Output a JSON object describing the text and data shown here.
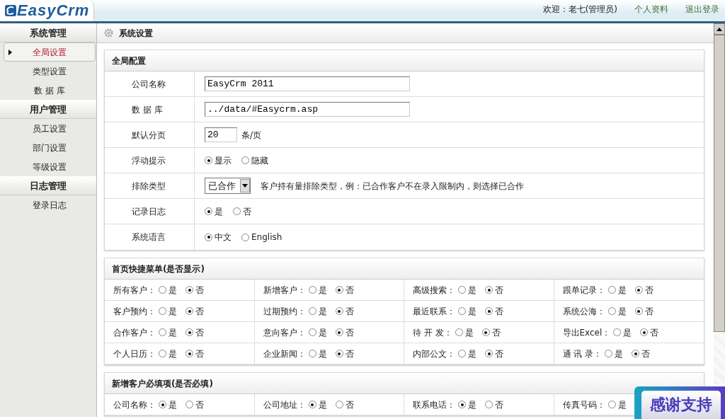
{
  "header": {
    "logo": "EasyCrm",
    "welcome": "欢迎：老七(管理员)",
    "links": [
      "个人资料",
      "退出登录"
    ]
  },
  "sidebar": {
    "groups": [
      {
        "title": "系统管理",
        "items": [
          {
            "label": "全局设置",
            "selected": true
          },
          {
            "label": "类型设置",
            "selected": false
          },
          {
            "label": "数 据 库",
            "selected": false
          }
        ]
      },
      {
        "title": "用户管理",
        "items": [
          {
            "label": "员工设置",
            "selected": false
          },
          {
            "label": "部门设置",
            "selected": false
          },
          {
            "label": "等级设置",
            "selected": false
          }
        ]
      },
      {
        "title": "日志管理",
        "items": [
          {
            "label": "登录日志",
            "selected": false
          }
        ]
      }
    ]
  },
  "page_title": "系统设置",
  "config": {
    "title": "全局配置",
    "rows": [
      {
        "label": "公司名称",
        "kind": "text",
        "value": "EasyCrm 2011"
      },
      {
        "label": "数 据 库",
        "kind": "text",
        "value": "../data/#Easycrm.asp"
      },
      {
        "label": "默认分页",
        "kind": "number",
        "value": "20",
        "unit": "条/页"
      },
      {
        "label": "浮动提示",
        "kind": "radio",
        "options": [
          {
            "label": "显示",
            "selected": true
          },
          {
            "label": "隐藏",
            "selected": false
          }
        ]
      },
      {
        "label": "排除类型",
        "kind": "select",
        "value": "已合作",
        "hint": "客户持有量排除类型，例：已合作客户不在录入限制内，则选择已合作"
      },
      {
        "label": "记录日志",
        "kind": "radio",
        "options": [
          {
            "label": "是",
            "selected": true
          },
          {
            "label": "否",
            "selected": false
          }
        ]
      },
      {
        "label": "系统语言",
        "kind": "radio",
        "options": [
          {
            "label": "中文",
            "selected": true
          },
          {
            "label": "English",
            "selected": false
          }
        ]
      }
    ]
  },
  "quick_menu": {
    "title": "首页快捷菜单(是否显示)",
    "items": [
      {
        "label": "所有客户：",
        "options": [
          {
            "label": "是",
            "selected": false
          },
          {
            "label": "否",
            "selected": true
          }
        ]
      },
      {
        "label": "新增客户：",
        "options": [
          {
            "label": "是",
            "selected": false
          },
          {
            "label": "否",
            "selected": true
          }
        ]
      },
      {
        "label": "高级搜索：",
        "options": [
          {
            "label": "是",
            "selected": false
          },
          {
            "label": "否",
            "selected": true
          }
        ]
      },
      {
        "label": "跟单记录：",
        "options": [
          {
            "label": "是",
            "selected": false
          },
          {
            "label": "否",
            "selected": true
          }
        ]
      },
      {
        "label": "客户预约：",
        "options": [
          {
            "label": "是",
            "selected": false
          },
          {
            "label": "否",
            "selected": true
          }
        ]
      },
      {
        "label": "过期预约：",
        "options": [
          {
            "label": "是",
            "selected": false
          },
          {
            "label": "否",
            "selected": true
          }
        ]
      },
      {
        "label": "最近联系：",
        "options": [
          {
            "label": "是",
            "selected": false
          },
          {
            "label": "否",
            "selected": true
          }
        ]
      },
      {
        "label": "系统公海：",
        "options": [
          {
            "label": "是",
            "selected": false
          },
          {
            "label": "否",
            "selected": true
          }
        ]
      },
      {
        "label": "合作客户：",
        "options": [
          {
            "label": "是",
            "selected": false
          },
          {
            "label": "否",
            "selected": true
          }
        ]
      },
      {
        "label": "意向客户：",
        "options": [
          {
            "label": "是",
            "selected": false
          },
          {
            "label": "否",
            "selected": true
          }
        ]
      },
      {
        "label": "待 开 发：",
        "options": [
          {
            "label": "是",
            "selected": false
          },
          {
            "label": "否",
            "selected": true
          }
        ]
      },
      {
        "label": "导出Excel：",
        "options": [
          {
            "label": "是",
            "selected": false
          },
          {
            "label": "否",
            "selected": true
          }
        ]
      },
      {
        "label": "个人日历：",
        "options": [
          {
            "label": "是",
            "selected": false
          },
          {
            "label": "否",
            "selected": true
          }
        ]
      },
      {
        "label": "企业新闻：",
        "options": [
          {
            "label": "是",
            "selected": false
          },
          {
            "label": "否",
            "selected": true
          }
        ]
      },
      {
        "label": "内部公文：",
        "options": [
          {
            "label": "是",
            "selected": false
          },
          {
            "label": "否",
            "selected": true
          }
        ]
      },
      {
        "label": "通 讯 录：",
        "options": [
          {
            "label": "是",
            "selected": false
          },
          {
            "label": "否",
            "selected": true
          }
        ]
      }
    ]
  },
  "required_fields": {
    "title": "新增客户必填项(是否必填)",
    "items": [
      {
        "label": "公司名称：",
        "options": [
          {
            "label": "是",
            "selected": true
          },
          {
            "label": "否",
            "selected": false
          }
        ]
      },
      {
        "label": "公司地址：",
        "options": [
          {
            "label": "是",
            "selected": true
          },
          {
            "label": "否",
            "selected": false
          }
        ]
      },
      {
        "label": "联系电话：",
        "options": [
          {
            "label": "是",
            "selected": true
          },
          {
            "label": "否",
            "selected": false
          }
        ]
      },
      {
        "label": "传真号码：",
        "options": [
          {
            "label": "是",
            "selected": false
          }
        ]
      }
    ]
  },
  "float_badge": "感谢支持"
}
